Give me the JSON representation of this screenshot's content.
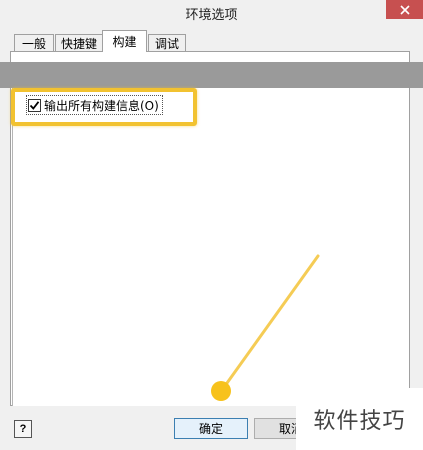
{
  "window": {
    "title": "环境选项",
    "close_icon": "close-icon"
  },
  "tabs": [
    {
      "label": "一般",
      "active": false
    },
    {
      "label": "快捷键",
      "active": false
    },
    {
      "label": "构建",
      "active": true
    },
    {
      "label": "调试",
      "active": false
    }
  ],
  "options": {
    "output_all_build_info": {
      "label": "输出所有构建信息(O)",
      "checked": true
    }
  },
  "footer": {
    "help_label": "?",
    "ok_label": "确定",
    "cancel_label": "取消"
  },
  "watermark": {
    "text": "软件技巧"
  },
  "colors": {
    "highlight": "#f2c230",
    "gray_bar": "#9a9a9a",
    "close_button": "#c75050"
  }
}
